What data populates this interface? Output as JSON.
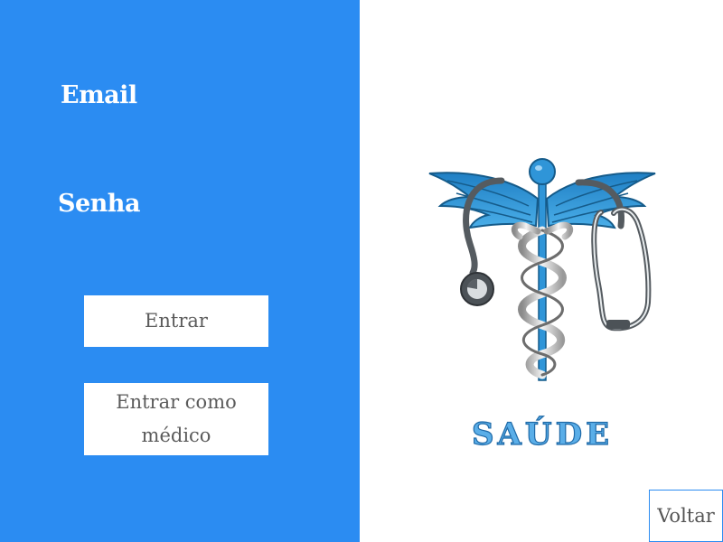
{
  "form": {
    "email_label": "Email",
    "password_label": "Senha"
  },
  "buttons": {
    "login": "Entrar",
    "login_doctor": "Entrar como médico",
    "back": "Voltar"
  },
  "logo": {
    "icon": "caduceus-stethoscope-icon",
    "text": "SAÚDE"
  },
  "colors": {
    "primary": "#2b8cf2",
    "logo_blue": "#2f95d8",
    "text_gray": "#5b5b5b"
  }
}
